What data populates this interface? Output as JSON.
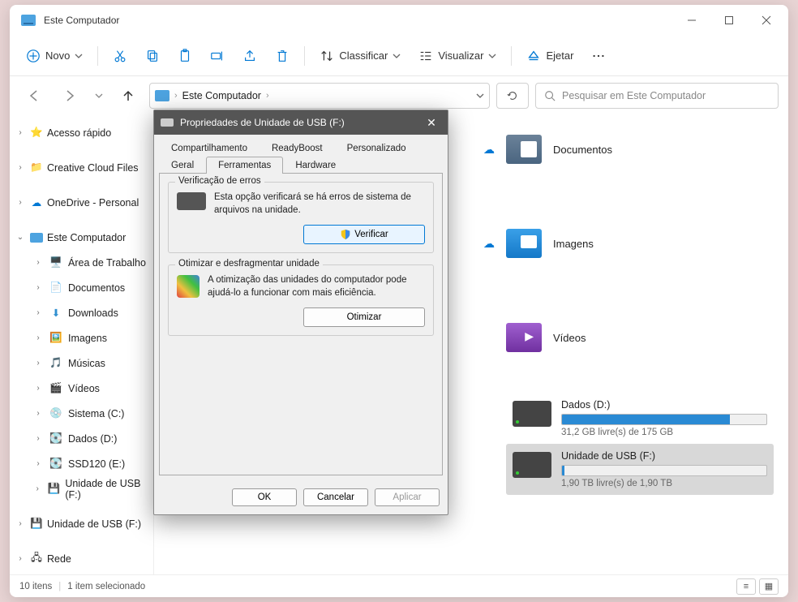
{
  "window": {
    "title": "Este Computador"
  },
  "toolbar": {
    "new": "Novo",
    "sort": "Classificar",
    "view": "Visualizar",
    "eject": "Ejetar"
  },
  "breadcrumb": {
    "location": "Este Computador"
  },
  "search": {
    "placeholder": "Pesquisar em Este Computador"
  },
  "sidebar": {
    "quick": "Acesso rápido",
    "creative": "Creative Cloud Files",
    "onedrive": "OneDrive - Personal",
    "thispc": "Este Computador",
    "items": [
      "Área de Trabalho",
      "Documentos",
      "Downloads",
      "Imagens",
      "Músicas",
      "Vídeos",
      "Sistema (C:)",
      "Dados (D:)",
      "SSD120 (E:)",
      "Unidade de USB (F:)"
    ],
    "usb2": "Unidade de USB (F:)",
    "network": "Rede"
  },
  "folders": {
    "documents": "Documentos",
    "images": "Imagens",
    "videos": "Vídeos"
  },
  "drives": {
    "d": {
      "name": "Dados (D:)",
      "free": "31,2 GB livre(s) de 175 GB",
      "fill": 82
    },
    "f": {
      "name": "Unidade de USB (F:)",
      "free": "1,90 TB livre(s) de 1,90 TB",
      "fill": 1
    }
  },
  "status": {
    "count": "10 itens",
    "selected": "1 item selecionado"
  },
  "dialog": {
    "title": "Propriedades de Unidade de USB (F:)",
    "tabs": {
      "share": "Compartilhamento",
      "readyboost": "ReadyBoost",
      "custom": "Personalizado",
      "general": "Geral",
      "tools": "Ferramentas",
      "hardware": "Hardware"
    },
    "errorcheck": {
      "title": "Verificação de erros",
      "desc": "Esta opção verificará se há erros de sistema de arquivos na unidade.",
      "button": "Verificar"
    },
    "optimize": {
      "title": "Otimizar e desfragmentar unidade",
      "desc": "A otimização das unidades do computador pode ajudá-lo a funcionar com mais eficiência.",
      "button": "Otimizar"
    },
    "buttons": {
      "ok": "OK",
      "cancel": "Cancelar",
      "apply": "Aplicar"
    }
  }
}
